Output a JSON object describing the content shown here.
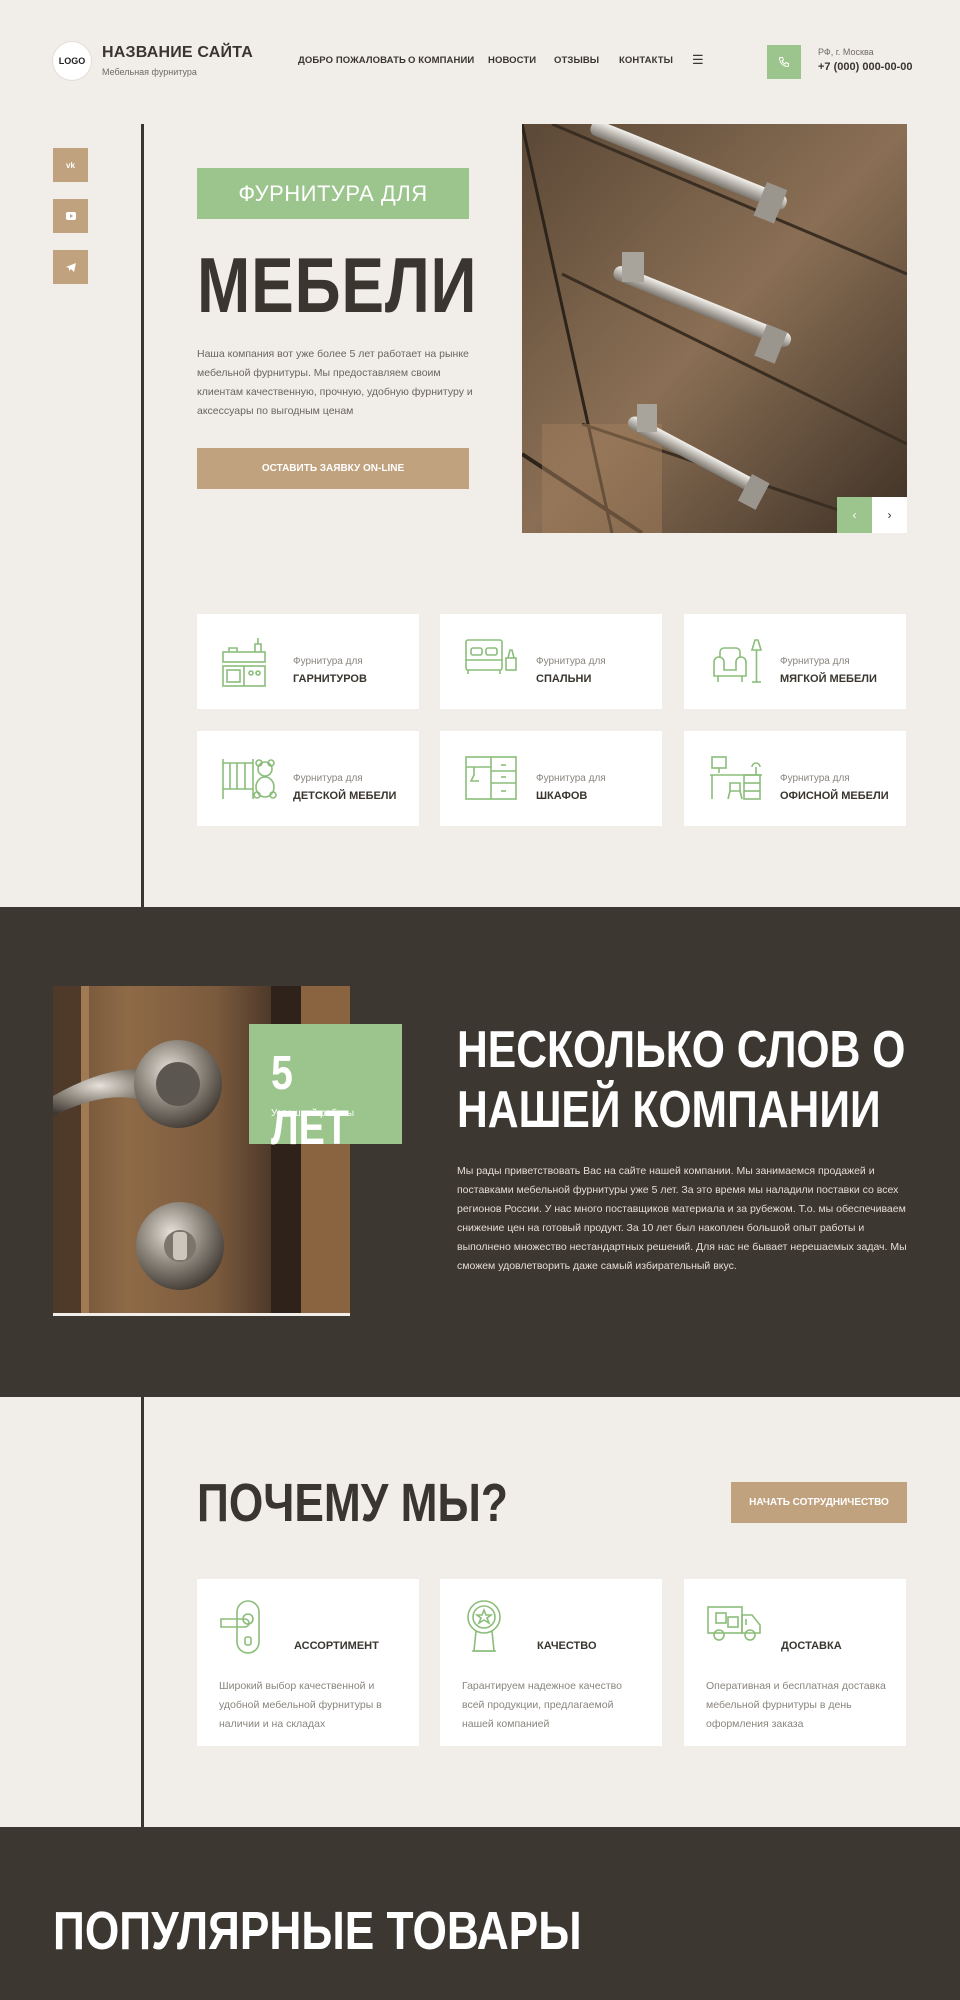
{
  "header": {
    "logo": "LOGO",
    "site_name": "НАЗВАНИЕ САЙТА",
    "site_sub": "Мебельная фурнитура",
    "nav": [
      "ДОБРО ПОЖАЛОВАТЬ",
      "О КОМПАНИИ",
      "НОВОСТИ",
      "ОТЗЫВЫ",
      "КОНТАКТЫ"
    ],
    "menu_icon": "☰",
    "region": "РФ, г. Москва",
    "phone": "+7 (000) 000-00-00"
  },
  "social": [
    "vk",
    "youtube",
    "telegram"
  ],
  "hero": {
    "tag": "ФУРНИТУРА ДЛЯ",
    "title": "МЕБЕЛИ",
    "text": "Наша компания вот уже более 5 лет работает на рынке мебельной фурнитуры. Мы предоставляем своим клиентам качественную, прочную, удобную фурнитуру и аксессуары по выгодным ценам",
    "button": "ОСТАВИТЬ ЗАЯВКУ ON-LINE",
    "prev": "‹",
    "next": "›"
  },
  "categories": [
    {
      "pre": "Фурнитура для",
      "name": "ГАРНИТУРОВ",
      "icon": "kitchen-icon"
    },
    {
      "pre": "Фурнитура для",
      "name": "СПАЛЬНИ",
      "icon": "bed-icon"
    },
    {
      "pre": "Фурнитура для",
      "name": "МЯГКОЙ МЕБЕЛИ",
      "icon": "armchair-icon"
    },
    {
      "pre": "Фурнитура для",
      "name": "ДЕТСКОЙ МЕБЕЛИ",
      "icon": "crib-icon"
    },
    {
      "pre": "Фурнитура для",
      "name": "ШКАФОВ",
      "icon": "wardrobe-icon"
    },
    {
      "pre": "Фурнитура для",
      "name": "ОФИСНОЙ МЕБЕЛИ",
      "icon": "office-desk-icon"
    }
  ],
  "about": {
    "badge_big": "5 ЛЕТ",
    "badge_small": "Успешной работы",
    "title": "НЕСКОЛЬКО СЛОВ О НАШЕЙ КОМПАНИИ",
    "text": "Мы рады приветствовать Вас на сайте нашей компании. Мы занимаемся продажей и поставками мебельной фурнитуры уже 5 лет. За это время мы наладили поставки со всех регионов России. У нас много поставщиков материала и за рубежом. Т.о. мы обеспечиваем снижение цен на готовый продукт. За 10 лет был накоплен большой  опыт работы и выполнено множество нестандартных решений. Для нас не бывает нерешаемых задач. Мы сможем удовлетворить даже самый избирательный вкус."
  },
  "why": {
    "title": "ПОЧЕМУ МЫ?",
    "button": "НАЧАТЬ СОТРУДНИЧЕСТВО",
    "cards": [
      {
        "title": "АССОРТИМЕНТ",
        "text": "Широкий выбор качественной и удобной мебельной фурнитуры в наличии и на складах",
        "icon": "door-handle-icon"
      },
      {
        "title": "КАЧЕСТВО",
        "text": "Гарантируем надежное качество всей продукции, предлагаемой нашей компанией",
        "icon": "award-icon"
      },
      {
        "title": "ДОСТАВКА",
        "text": "Оперативная и бесплатная доставка мебельной фурнитуры в день оформления заказа",
        "icon": "truck-icon"
      }
    ]
  },
  "popular": {
    "title": "ПОПУЛЯРНЫЕ ТОВАРЫ"
  },
  "colors": {
    "green": "#9cc58d",
    "tan": "#c1a27e",
    "dark": "#3d3731",
    "bg": "#f1eeea"
  }
}
